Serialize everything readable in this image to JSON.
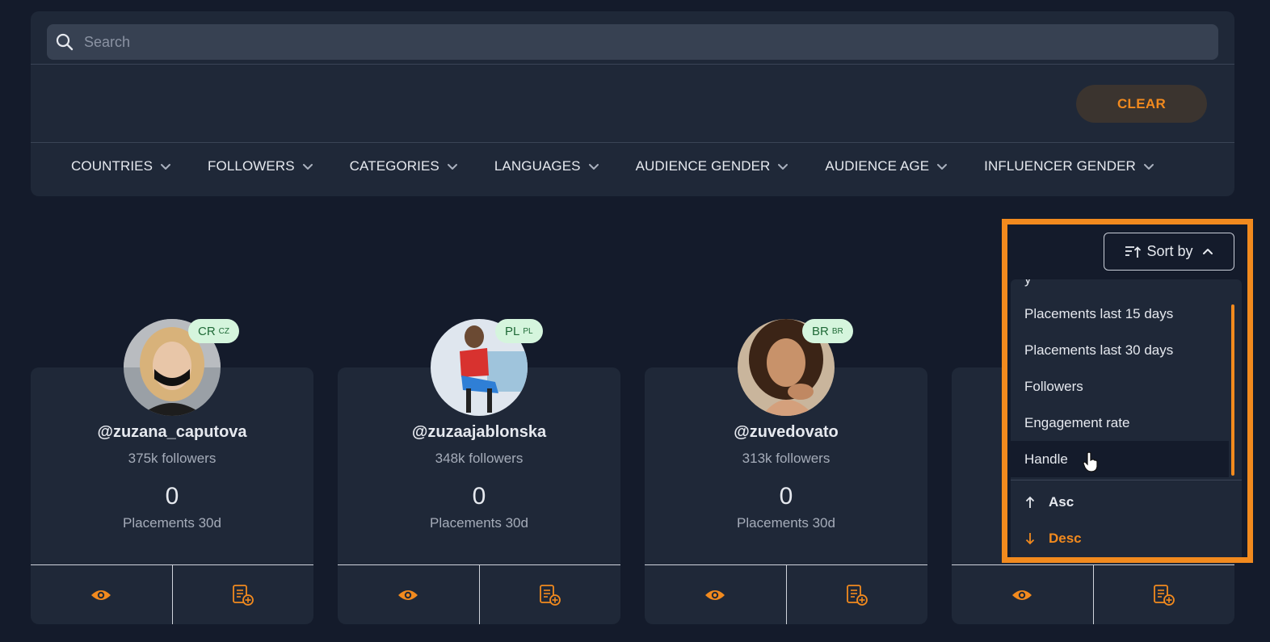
{
  "search": {
    "placeholder": "Search"
  },
  "clear_label": "CLEAR",
  "filters": [
    "COUNTRIES",
    "FOLLOWERS",
    "CATEGORIES",
    "LANGUAGES",
    "AUDIENCE GENDER",
    "AUDIENCE AGE",
    "INFLUENCER GENDER"
  ],
  "cards": [
    {
      "handle": "@zuzana_caputova",
      "followers": "375k followers",
      "placements": "0",
      "placements_label": "Placements 30d",
      "badge_code": "CR",
      "badge_flag": "CZ"
    },
    {
      "handle": "@zuzaajablonska",
      "followers": "348k followers",
      "placements": "0",
      "placements_label": "Placements 30d",
      "badge_code": "PL",
      "badge_flag": "PL"
    },
    {
      "handle": "@zuvedovato",
      "followers": "313k followers",
      "placements": "0",
      "placements_label": "Placements 30d",
      "badge_code": "BR",
      "badge_flag": "BR"
    }
  ],
  "sort": {
    "button_label": "Sort by",
    "options": [
      "Placements last 15 days",
      "Placements last 30 days",
      "Followers",
      "Engagement rate",
      "Handle"
    ],
    "hovered": "Handle",
    "asc_label": "Asc",
    "desc_label": "Desc",
    "selected_direction": "Desc"
  },
  "colors": {
    "accent": "#f28a1e",
    "background": "#141b2b",
    "panel": "#1f2838",
    "badge_bg": "#d5f5dd",
    "badge_text": "#1f6a37"
  },
  "icons": {
    "search": "search-icon",
    "chevron": "chevron-down-icon",
    "view": "eye-icon",
    "add_to_list": "add-to-list-icon",
    "sort": "sort-icon"
  }
}
